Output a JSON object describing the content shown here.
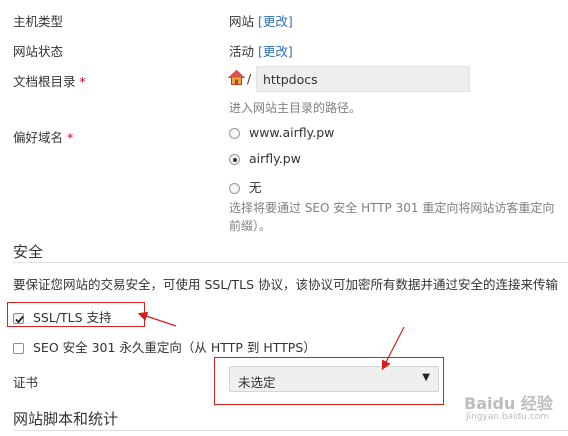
{
  "host_type": {
    "label": "主机类型",
    "value": "网站",
    "change_link": "[更改]"
  },
  "site_status": {
    "label": "网站状态",
    "value": "活动",
    "change_link": "[更改]"
  },
  "doc_root": {
    "label": "文档根目录",
    "required_mark": "*",
    "prefix": "/",
    "value": "httpdocs",
    "hint": "进入网站主目录的路径。"
  },
  "preferred_domain": {
    "label": "偏好域名",
    "required_mark": "*",
    "options": [
      {
        "label": "www.airfly.pw",
        "selected": false
      },
      {
        "label": "airfly.pw",
        "selected": true
      },
      {
        "label": "无",
        "selected": false
      }
    ],
    "hint_line1": "选择将要通过 SEO 安全 HTTP 301 重定向将网站访客重定向",
    "hint_line2": "前缀）。"
  },
  "security": {
    "heading": "安全",
    "description": "要保证您网站的交易安全，可使用 SSL/TLS 协议，该协议可加密所有数据并通过安全的连接来传输",
    "ssl_support": {
      "label": "SSL/TLS 支持",
      "checked": true
    },
    "seo_redirect": {
      "label": "SEO 安全 301 永久重定向（从 HTTP 到 HTTPS）",
      "checked": false
    },
    "certificate": {
      "label": "证书",
      "selected": "未选定"
    }
  },
  "scripting": {
    "heading": "网站脚本和统计"
  },
  "watermark": {
    "text": "Baidu 经验",
    "url": "jingyan.baidu.com"
  },
  "colors": {
    "annotation": "#d61f1f",
    "link": "#2f6fb8",
    "hint": "#808080"
  }
}
